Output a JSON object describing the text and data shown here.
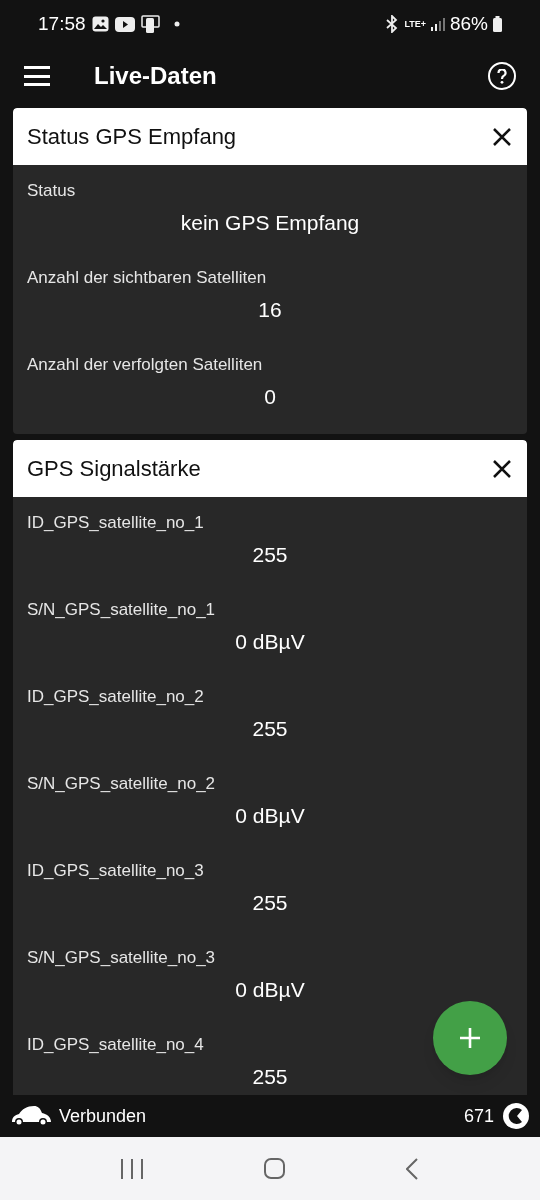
{
  "status_bar": {
    "time": "17:58",
    "network": "LTE+",
    "battery": "86%"
  },
  "app_bar": {
    "title": "Live-Daten"
  },
  "cards": [
    {
      "title": "Status GPS Empfang",
      "rows": [
        {
          "label": "Status",
          "value": "kein GPS Empfang"
        },
        {
          "label": "Anzahl der sichtbaren Satelliten",
          "value": "16"
        },
        {
          "label": "Anzahl der verfolgten Satelliten",
          "value": "0"
        }
      ]
    },
    {
      "title": "GPS Signalstärke",
      "rows": [
        {
          "label": "ID_GPS_satellite_no_1",
          "value": "255"
        },
        {
          "label": "S/N_GPS_satellite_no_1",
          "value": "0 dBµV"
        },
        {
          "label": "ID_GPS_satellite_no_2",
          "value": "255"
        },
        {
          "label": "S/N_GPS_satellite_no_2",
          "value": "0 dBµV"
        },
        {
          "label": "ID_GPS_satellite_no_3",
          "value": "255"
        },
        {
          "label": "S/N_GPS_satellite_no_3",
          "value": "0 dBµV"
        },
        {
          "label": "ID_GPS_satellite_no_4",
          "value": "255"
        }
      ]
    }
  ],
  "footer": {
    "status": "Verbunden",
    "count": "671"
  }
}
